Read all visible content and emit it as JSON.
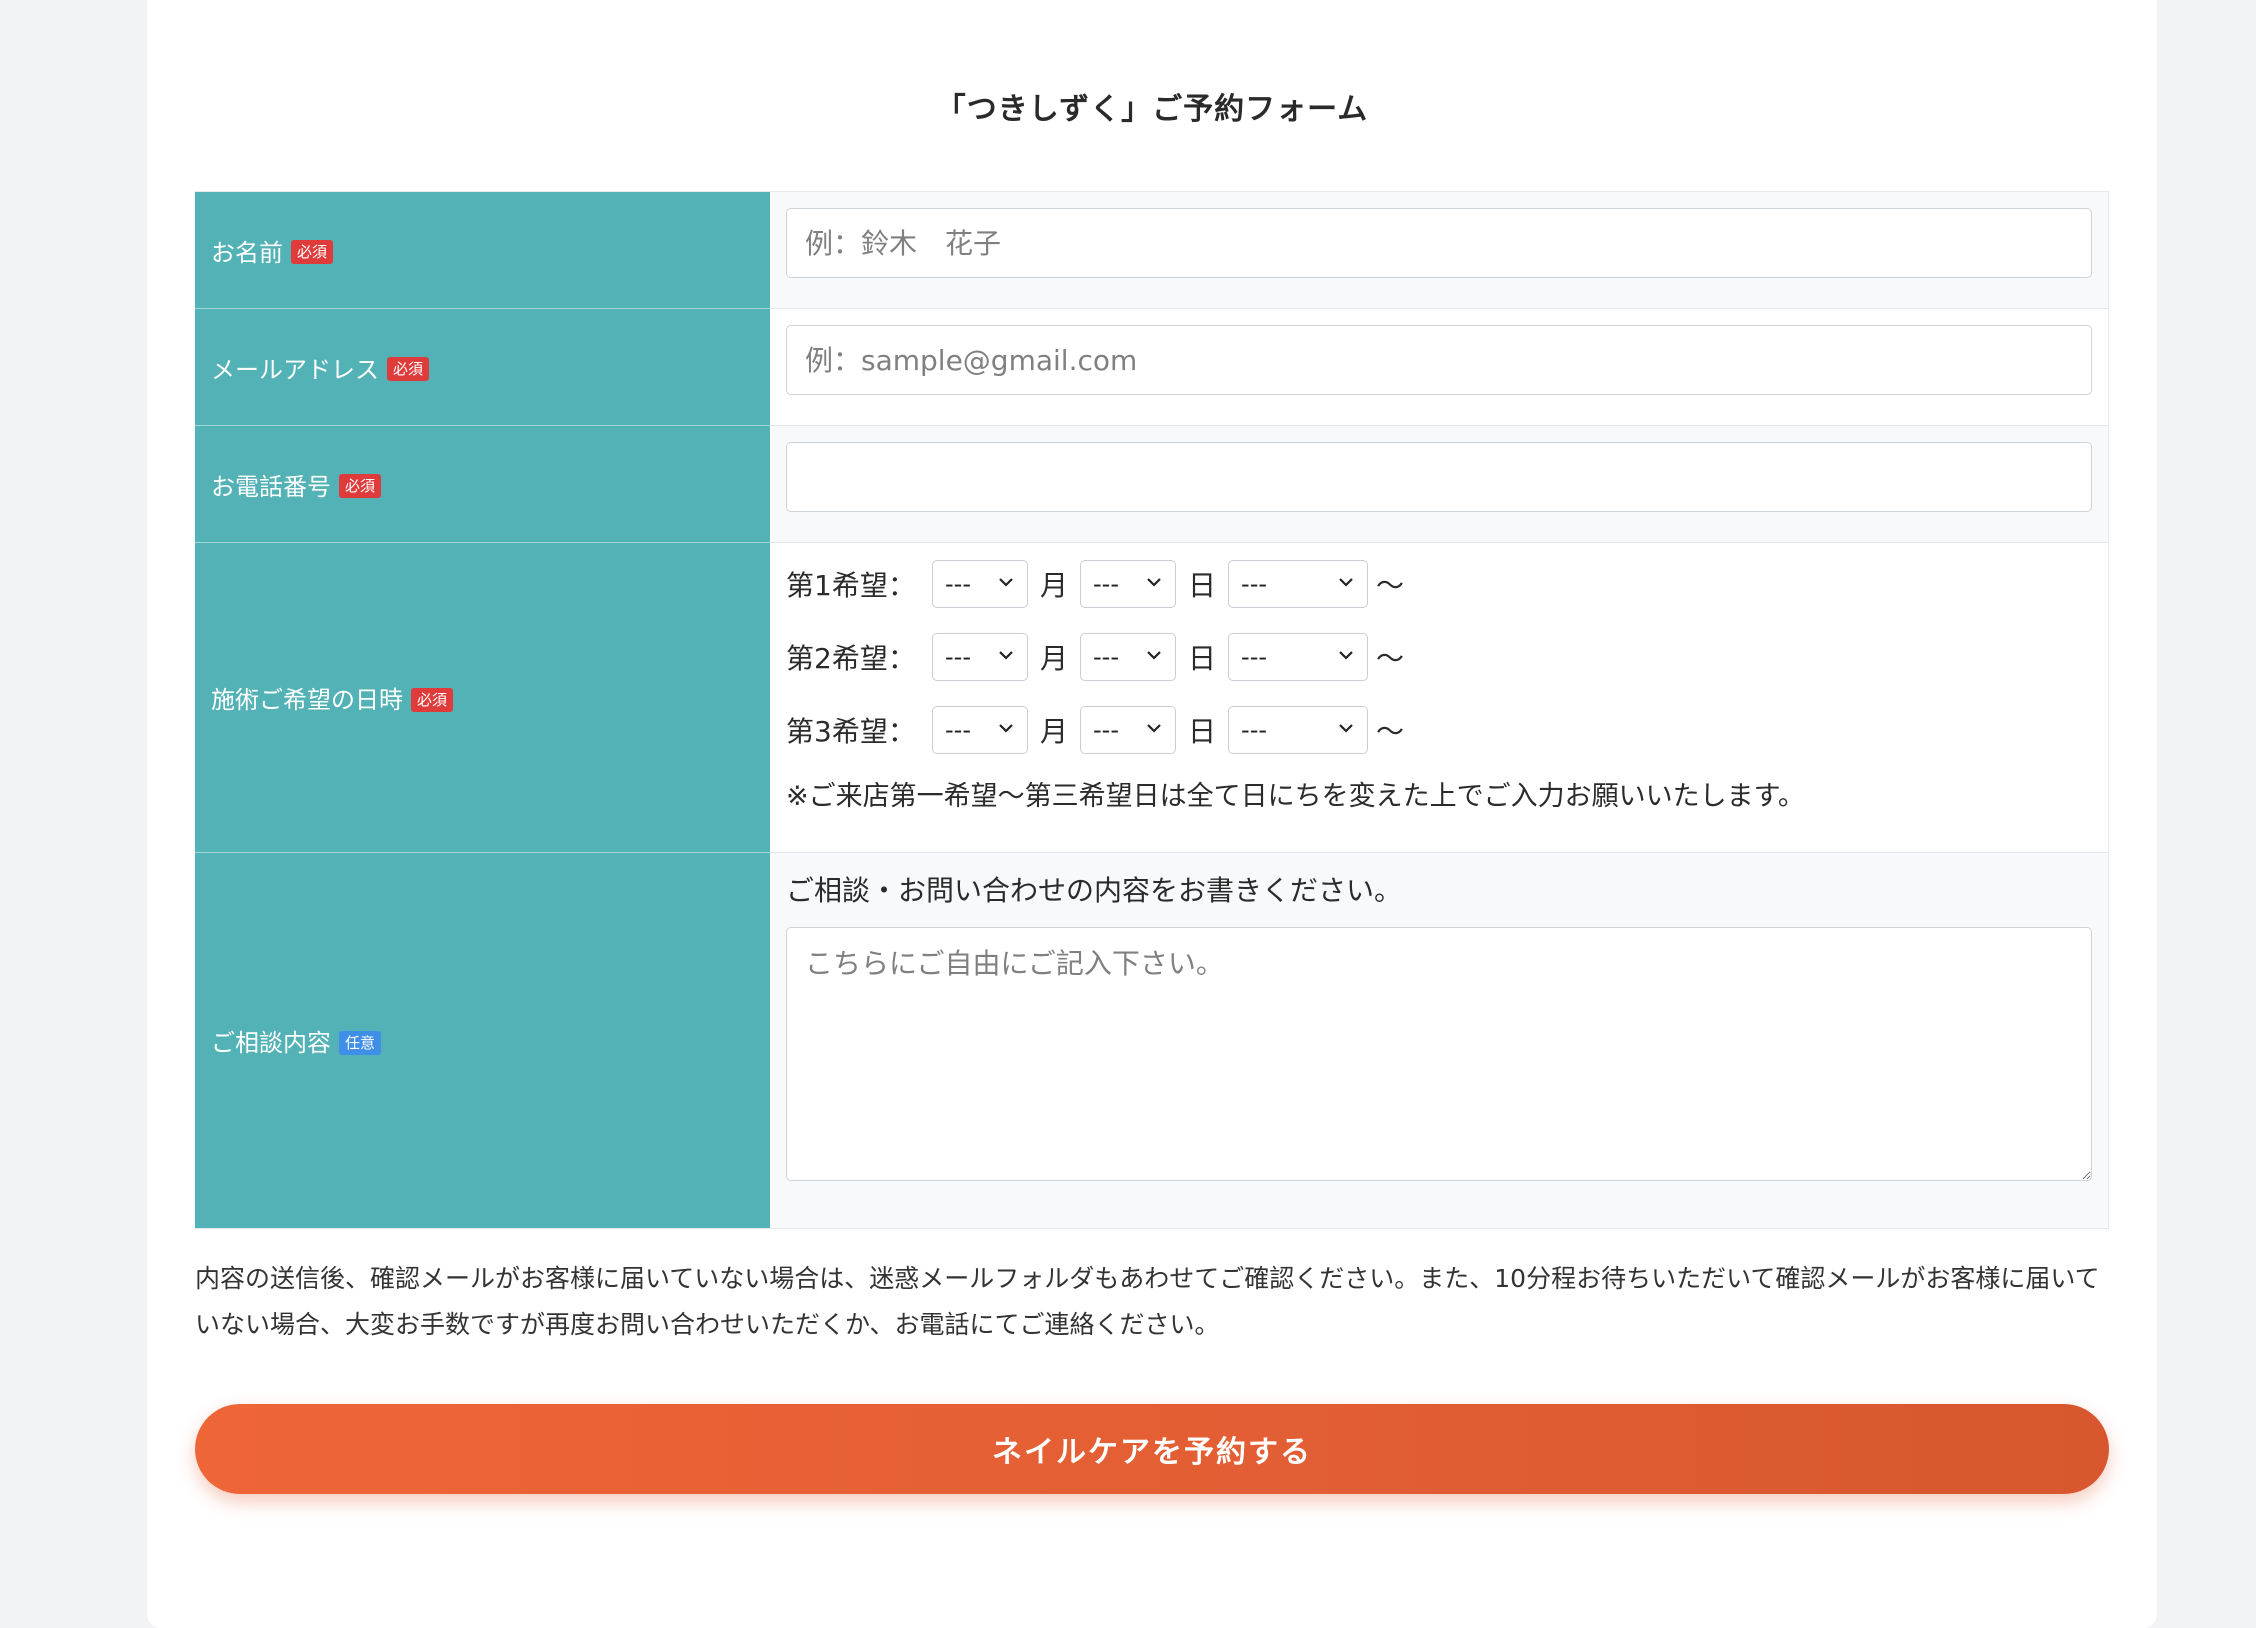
{
  "form": {
    "title": "「つきしずく」ご予約フォーム",
    "badges": {
      "required": "必須",
      "optional": "任意"
    },
    "name": {
      "label": "お名前",
      "placeholder": "例：鈴木　花子",
      "value": ""
    },
    "email": {
      "label": "メールアドレス",
      "placeholder": "例：sample@gmail.com",
      "value": ""
    },
    "phone": {
      "label": "お電話番号",
      "placeholder": "",
      "value": ""
    },
    "datetime": {
      "label": "施術ご希望の日時",
      "month_unit": "月",
      "day_unit": "日",
      "tilde": "〜",
      "preferences": [
        {
          "label": "第1希望：",
          "month": "---",
          "day": "---",
          "time": "---"
        },
        {
          "label": "第2希望：",
          "month": "---",
          "day": "---",
          "time": "---"
        },
        {
          "label": "第3希望：",
          "month": "---",
          "day": "---",
          "time": "---"
        }
      ],
      "note": "※ご来店第一希望〜第三希望日は全て日にちを変えた上でご入力お願いいたします。"
    },
    "consultation": {
      "label": "ご相談内容",
      "prompt": "ご相談・お問い合わせの内容をお書きください。",
      "placeholder": "こちらにご自由にご記入下さい。",
      "value": ""
    },
    "notice": "内容の送信後、確認メールがお客様に届いていない場合は、迷惑メールフォルダもあわせてご確認ください。また、10分程お待ちいただいて確認メールがお客様に届いていない場合、大変お手数ですが再度お問い合わせいただくか、お電話にてご連絡ください。",
    "submit_label": "ネイルケアを予約する"
  },
  "colors": {
    "label_background": "#52b2b5",
    "required_badge": "#e03b3b",
    "optional_badge": "#3f8fe8",
    "submit_button": "#e35e34"
  }
}
